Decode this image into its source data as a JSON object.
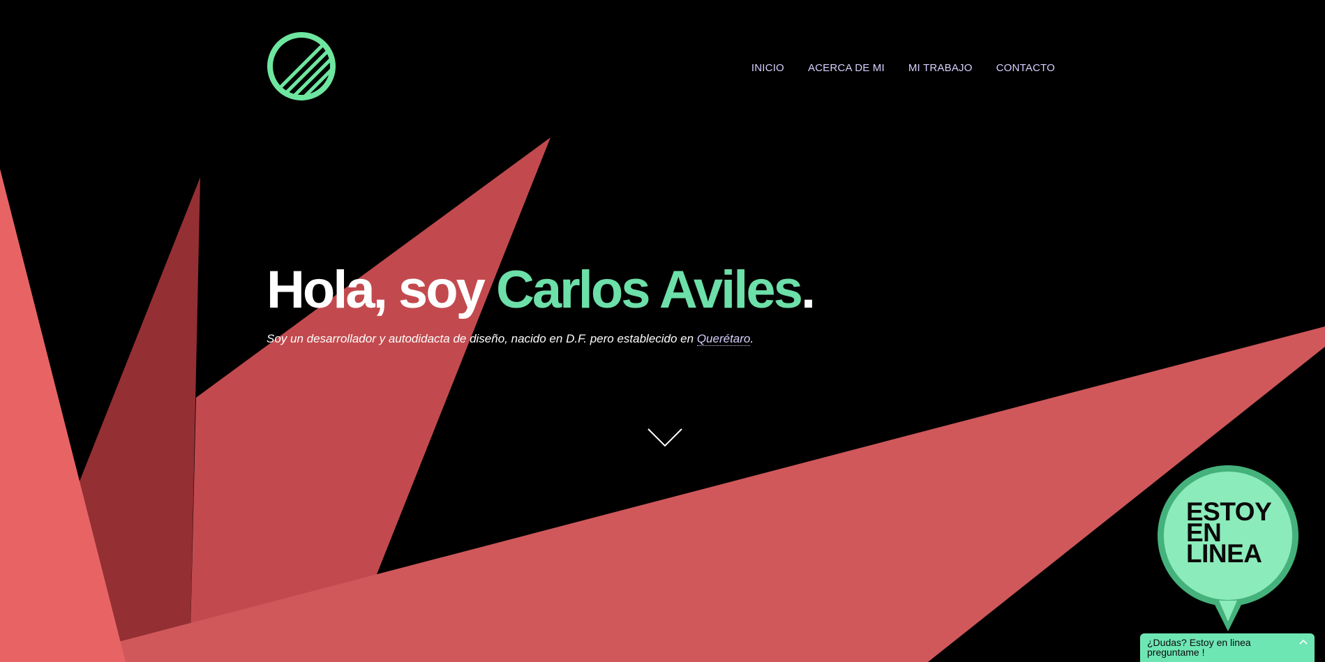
{
  "nav": {
    "items": [
      {
        "label": "INICIO"
      },
      {
        "label": "ACERCA DE MI"
      },
      {
        "label": "MI TRABAJO"
      },
      {
        "label": "CONTACTO"
      }
    ]
  },
  "hero": {
    "greeting": "Hola, soy ",
    "name": "Carlos Aviles",
    "period": ".",
    "subtitle_prefix": "Soy un desarrollador y autodidacta de diseño, nacido en D.F. pero establecido en ",
    "subtitle_link": "Querétaro",
    "subtitle_suffix": "."
  },
  "online_badge": {
    "line1": "ESTOY",
    "line2": "EN",
    "line3": "LINEA"
  },
  "chat": {
    "text": "¿Dudas? Estoy en linea preguntame !"
  },
  "icons": {
    "logo": "striped-circle-logo-icon",
    "scroll": "chevron-down-icon",
    "chat_toggle": "chevron-up-icon"
  },
  "colors": {
    "background": "#000000",
    "accent_green": "#6ddfa9",
    "nav_text": "#d7d0ff",
    "coral_light": "#e86464",
    "coral_mid": "#c24a4e",
    "coral_dark": "#942f34",
    "coral_large": "#d0585b",
    "badge_green": "#8cebbb",
    "badge_ring": "#45b27c"
  }
}
